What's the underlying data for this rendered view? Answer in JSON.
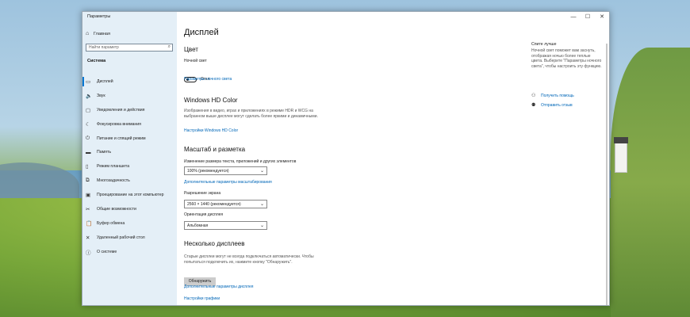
{
  "window": {
    "title": "Параметры",
    "controls": [
      "—",
      "☐",
      "✕"
    ]
  },
  "sidebar": {
    "home": "Главная",
    "search_placeholder": "Найти параметр",
    "section": "Система",
    "items": [
      {
        "icon": "monitor-icon",
        "glyph": "▭",
        "label": "Дисплей"
      },
      {
        "icon": "sound-icon",
        "glyph": "🔈",
        "label": "Звук"
      },
      {
        "icon": "notifications-icon",
        "glyph": "▢",
        "label": "Уведомления и действия"
      },
      {
        "icon": "focus-icon",
        "glyph": "☾",
        "label": "Фокусировка внимания"
      },
      {
        "icon": "power-icon",
        "glyph": "⏻",
        "label": "Питание и спящий режим"
      },
      {
        "icon": "storage-icon",
        "glyph": "▬",
        "label": "Память"
      },
      {
        "icon": "tablet-icon",
        "glyph": "▯",
        "label": "Режим планшета"
      },
      {
        "icon": "multitasking-icon",
        "glyph": "⧉",
        "label": "Многозадачность"
      },
      {
        "icon": "projecting-icon",
        "glyph": "▣",
        "label": "Проецирование на этот компьютер"
      },
      {
        "icon": "shared-icon",
        "glyph": "✂",
        "label": "Общие возможности"
      },
      {
        "icon": "clipboard-icon",
        "glyph": "📋",
        "label": "Буфер обмена"
      },
      {
        "icon": "remote-desktop-icon",
        "glyph": "✕",
        "label": "Удаленный рабочий стол"
      },
      {
        "icon": "info-icon",
        "glyph": "ⓘ",
        "label": "О системе"
      }
    ]
  },
  "content": {
    "title": "Дисплей",
    "color_heading": "Цвет",
    "night_light_label": "Ночной свет",
    "night_light_state": "Откл.",
    "night_light_link": "Параметры ночного света",
    "hd_heading": "Windows HD Color",
    "hd_desc": "Изображения в видео, играх и приложениях в режиме HDR и WCG на выбранном выше дисплее могут сделать более яркими и динамичными.",
    "hd_link": "Настройки Windows HD Color",
    "scale_heading": "Масштаб и разметка",
    "scale_label": "Изменение размера текста, приложений и других элементов",
    "scale_value": "100% (рекомендуется)",
    "scale_link": "Дополнительные параметры масштабирования",
    "resolution_label": "Разрешение экрана",
    "resolution_value": "2560 × 1440 (рекомендуется)",
    "orientation_label": "Ориентация дисплея",
    "orientation_value": "Альбомная",
    "multi_heading": "Несколько дисплеев",
    "multi_desc": "Старые дисплеи могут не всегда подключаться автоматически. Чтобы попытаться подключить их, нажмите кнопку \"Обнаружить\".",
    "detect_button": "Обнаружить",
    "advanced_link": "Дополнительные параметры дисплея",
    "graphics_link": "Настройки графики"
  },
  "right": {
    "title": "Спите лучше",
    "text": "Ночной свет поможет вам заснуть, отображая ночью более теплые цвета. Выберите \"Параметры ночного света\", чтобы настроить эту функцию.",
    "help_link": "Получить помощь",
    "feedback_link": "Отправить отзыв"
  }
}
